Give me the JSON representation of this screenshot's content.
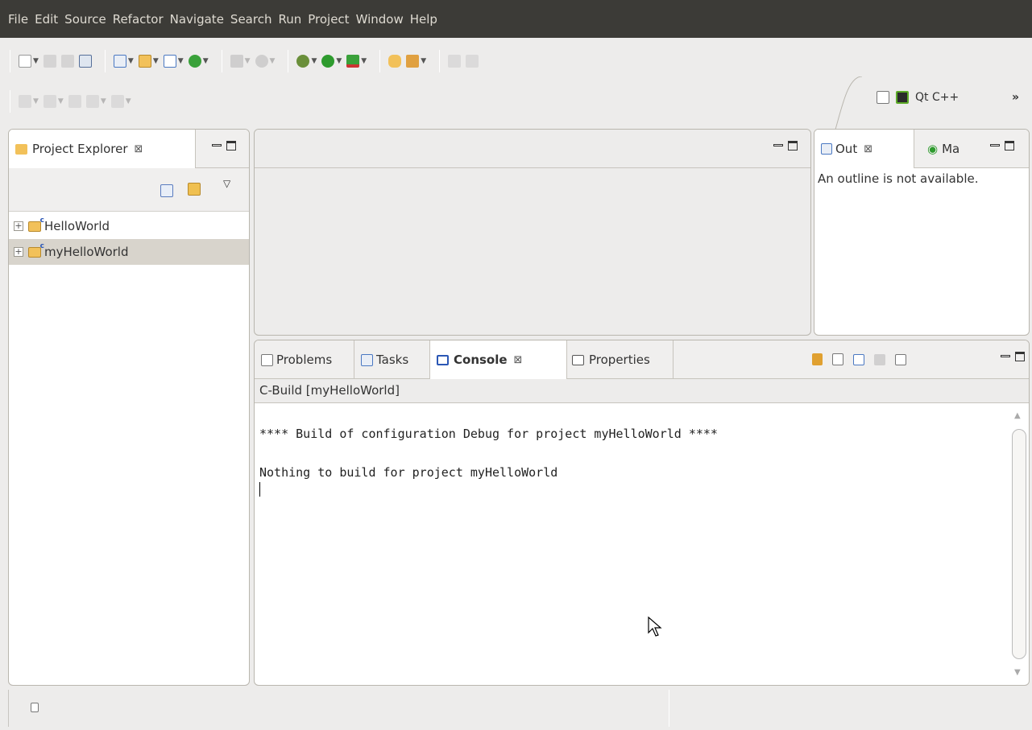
{
  "menubar": {
    "items": [
      "File",
      "Edit",
      "Source",
      "Refactor",
      "Navigate",
      "Search",
      "Run",
      "Project",
      "Window",
      "Help"
    ]
  },
  "perspective": {
    "label": "Qt C++",
    "more": "»"
  },
  "project_explorer": {
    "title": "Project Explorer",
    "close": "⊠",
    "items": [
      {
        "label": "HelloWorld",
        "selected": false
      },
      {
        "label": "myHelloWorld",
        "selected": true
      }
    ]
  },
  "outline": {
    "tab_out": "Out",
    "tab_ma": "Ma",
    "close": "⊠",
    "message": "An outline is not available."
  },
  "bottom_tabs": {
    "problems": "Problems",
    "tasks": "Tasks",
    "console": "Console",
    "properties": "Properties",
    "close": "⊠"
  },
  "console": {
    "header": "C-Build [myHelloWorld]",
    "lines": [
      "**** Build of configuration Debug for project myHelloWorld ****",
      "",
      "Nothing to build for project myHelloWorld"
    ]
  },
  "colors": {
    "menubar_bg": "#3c3b37",
    "selection": "#d8d4cc",
    "panel_bg": "#edeceb"
  }
}
